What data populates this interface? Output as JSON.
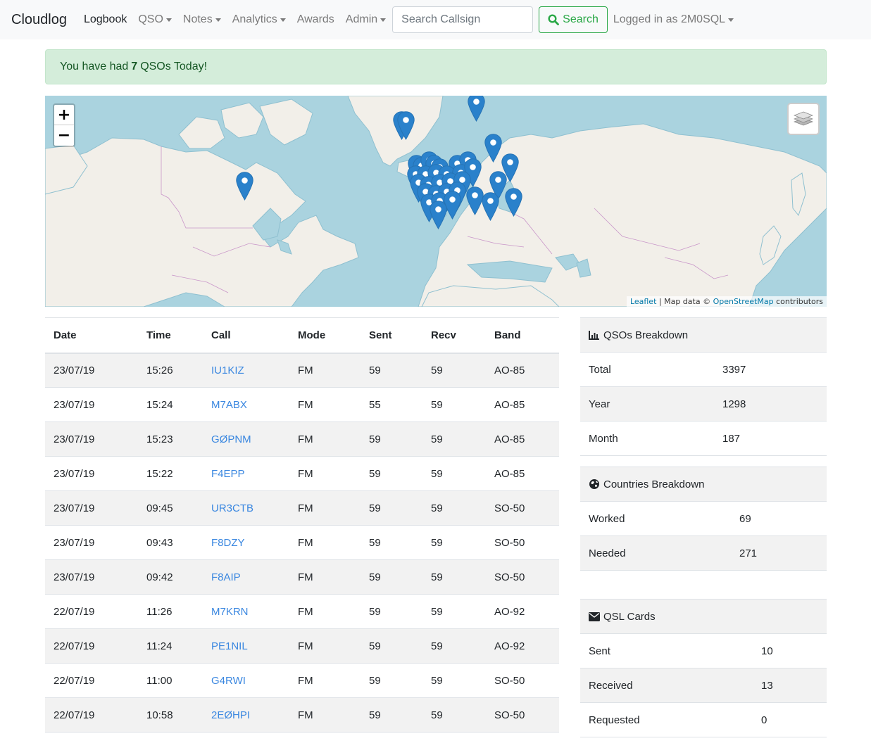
{
  "navbar": {
    "brand": "Cloudlog",
    "links": [
      {
        "label": "Logbook",
        "dropdown": false,
        "active": true
      },
      {
        "label": "QSO",
        "dropdown": true,
        "active": false
      },
      {
        "label": "Notes",
        "dropdown": true,
        "active": false
      },
      {
        "label": "Analytics",
        "dropdown": true,
        "active": false
      },
      {
        "label": "Awards",
        "dropdown": false,
        "active": false
      },
      {
        "label": "Admin",
        "dropdown": true,
        "active": false
      }
    ],
    "search_placeholder": "Search Callsign",
    "search_value": "",
    "search_button": "Search",
    "user_menu": "Logged in as 2M0SQL"
  },
  "alert": {
    "prefix": "You have had",
    "count": "7",
    "suffix": "QSOs Today!"
  },
  "map": {
    "zoom_in": "+",
    "zoom_out": "−",
    "attribution": {
      "leaflet": "Leaflet",
      "separator": " | Map data © ",
      "osm": "OpenStreetMap",
      "suffix": " contributors"
    },
    "marker_color": "#2a81cb"
  },
  "log": {
    "columns": [
      "Date",
      "Time",
      "Call",
      "Mode",
      "Sent",
      "Recv",
      "Band"
    ],
    "rows": [
      [
        "23/07/19",
        "15:26",
        "IU1KIZ",
        "FM",
        "59",
        "59",
        "AO-85"
      ],
      [
        "23/07/19",
        "15:24",
        "M7ABX",
        "FM",
        "55",
        "59",
        "AO-85"
      ],
      [
        "23/07/19",
        "15:23",
        "GØPNM",
        "FM",
        "59",
        "59",
        "AO-85"
      ],
      [
        "23/07/19",
        "15:22",
        "F4EPP",
        "FM",
        "59",
        "59",
        "AO-85"
      ],
      [
        "23/07/19",
        "09:45",
        "UR3CTB",
        "FM",
        "59",
        "59",
        "SO-50"
      ],
      [
        "23/07/19",
        "09:43",
        "F8DZY",
        "FM",
        "59",
        "59",
        "SO-50"
      ],
      [
        "23/07/19",
        "09:42",
        "F8AIP",
        "FM",
        "59",
        "59",
        "SO-50"
      ],
      [
        "22/07/19",
        "11:26",
        "M7KRN",
        "FM",
        "59",
        "59",
        "AO-92"
      ],
      [
        "22/07/19",
        "11:24",
        "PE1NIL",
        "FM",
        "59",
        "59",
        "AO-92"
      ],
      [
        "22/07/19",
        "11:00",
        "G4RWI",
        "FM",
        "59",
        "59",
        "SO-50"
      ],
      [
        "22/07/19",
        "10:58",
        "2EØHPI",
        "FM",
        "59",
        "59",
        "SO-50"
      ]
    ]
  },
  "qso_breakdown": {
    "title": "QSOs Breakdown",
    "icon": "bar-chart-icon",
    "rows": [
      {
        "label": "Total",
        "value": "3397"
      },
      {
        "label": "Year",
        "value": "1298"
      },
      {
        "label": "Month",
        "value": "187"
      }
    ]
  },
  "countries_breakdown": {
    "title": "Countries Breakdown",
    "icon": "globe-icon",
    "rows": [
      {
        "label": "Worked",
        "value": "69"
      },
      {
        "label": "Needed",
        "value": "271"
      }
    ]
  },
  "qsl_cards": {
    "title": "QSL Cards",
    "icon": "envelope-icon",
    "rows": [
      {
        "label": "Sent",
        "value": "10"
      },
      {
        "label": "Received",
        "value": "13"
      },
      {
        "label": "Requested",
        "value": "0"
      }
    ]
  }
}
